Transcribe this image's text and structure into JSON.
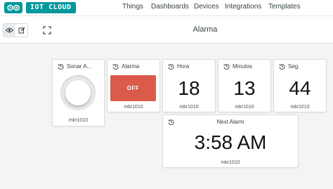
{
  "header": {
    "brand": "IOT CLOUD",
    "nav": [
      "Things",
      "Dashboards",
      "Devices",
      "Integrations",
      "Templates"
    ]
  },
  "dashboard": {
    "title": "Alarma"
  },
  "widgets": {
    "sonar": {
      "title": "Sonar A...",
      "device": "mkr1010"
    },
    "alarma": {
      "title": "Alarma",
      "state": "OFF",
      "device": "mkr1010"
    },
    "hora": {
      "title": "Hora",
      "value": "18",
      "device": "mkr1010"
    },
    "minutos": {
      "title": "Minutos",
      "value": "13",
      "device": "mkr1010"
    },
    "seg": {
      "title": "Seg.",
      "value": "44",
      "device": "mkr1010"
    },
    "next_alarm": {
      "title": "Next Alarm",
      "value": "3:58 AM",
      "device": "mkr1010"
    }
  },
  "colors": {
    "brand": "#00979d",
    "switch_off": "#da5b4a"
  }
}
